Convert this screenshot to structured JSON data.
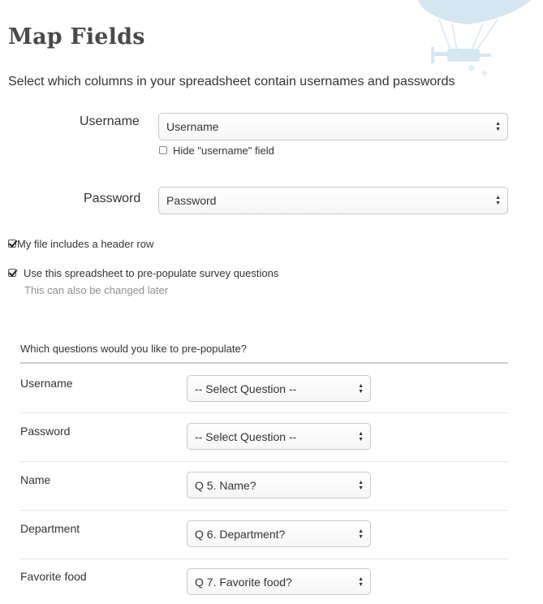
{
  "page": {
    "title": "Map Fields",
    "subtitle": "Select which columns in your spreadsheet contain usernames and passwords"
  },
  "username_field": {
    "label": "Username",
    "selected": "Username",
    "hide_checkbox_label": "Hide \"username\" field",
    "hide_checked": false
  },
  "password_field": {
    "label": "Password",
    "selected": "Password"
  },
  "options": {
    "header_row_label": "My file includes a header row",
    "header_row_checked": true,
    "prepopulate_label": "Use this spreadsheet to pre-populate survey questions",
    "prepopulate_checked": true,
    "prepopulate_hint": "This can also be changed later"
  },
  "questions": {
    "header": "Which questions would you like to pre-populate?",
    "rows": [
      {
        "label": "Username",
        "selected": "-- Select Question --"
      },
      {
        "label": "Password",
        "selected": "-- Select Question --"
      },
      {
        "label": "Name",
        "selected": "Q 5. Name?"
      },
      {
        "label": "Department",
        "selected": "Q 6. Department?"
      },
      {
        "label": "Favorite food",
        "selected": "Q 7. Favorite food?"
      }
    ]
  },
  "colors": {
    "balloon": "#d6e7f1",
    "text": "#333333",
    "hint": "#8f8f8f"
  },
  "icons": {
    "decoration": "hot-air-balloon-icon",
    "select_arrows": "select-arrows-icon",
    "checkbox_check": "check-icon"
  }
}
